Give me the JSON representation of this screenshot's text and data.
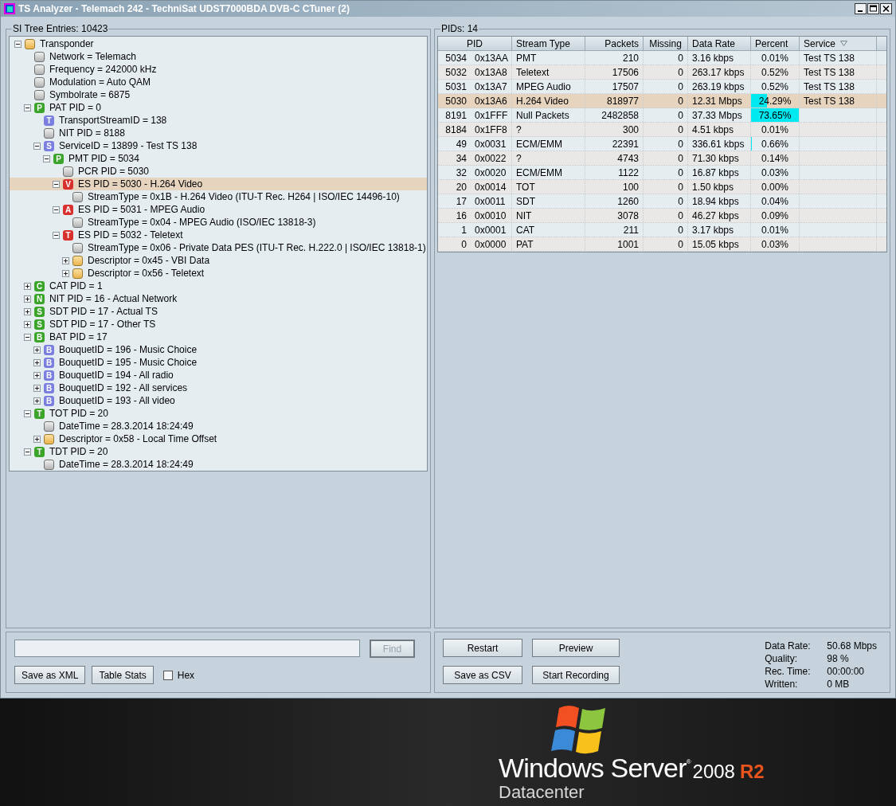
{
  "window": {
    "title": "TS Analyzer - Telemach 242 - TechniSat UDST7000BDA DVB-C CTuner (2)"
  },
  "tree_panel": {
    "legend": "SI Tree Entries: 10423",
    "nodes": [
      {
        "label": "Transponder",
        "kind": "group",
        "expanded": true,
        "selected": false,
        "children": [
          {
            "label": "Network = Telemach",
            "kind": "value",
            "selected": false
          },
          {
            "label": "Frequency = 242000 kHz",
            "kind": "value",
            "selected": false
          },
          {
            "label": "Modulation = Auto QAM",
            "kind": "value",
            "selected": false
          },
          {
            "label": "Symbolrate = 6875",
            "kind": "value",
            "selected": false
          },
          {
            "label": "PAT PID = 0",
            "kind": "table",
            "letter": "P",
            "color": "#3aa52a",
            "expanded": true,
            "selected": false,
            "children": [
              {
                "label": "TransportStreamID = 138",
                "kind": "table",
                "letter": "T",
                "color": "#7b7fe0",
                "selected": false
              },
              {
                "label": "NIT PID = 8188",
                "kind": "value",
                "selected": false
              },
              {
                "label": "ServiceID = 13899 - Test TS 138",
                "kind": "table",
                "letter": "S",
                "color": "#7b7fe0",
                "expanded": true,
                "selected": false,
                "children": [
                  {
                    "label": "PMT PID = 5034",
                    "kind": "table",
                    "letter": "P",
                    "color": "#3aa52a",
                    "expanded": true,
                    "selected": false,
                    "children": [
                      {
                        "label": "PCR PID = 5030",
                        "kind": "value",
                        "selected": false
                      },
                      {
                        "label": "ES PID = 5030 - H.264 Video",
                        "kind": "table",
                        "letter": "V",
                        "color": "#d8302c",
                        "expanded": true,
                        "selected": true,
                        "children": [
                          {
                            "label": "StreamType = 0x1B - H.264 Video (ITU-T Rec. H264 | ISO/IEC 14496-10)",
                            "kind": "value",
                            "selected": false
                          }
                        ]
                      },
                      {
                        "label": "ES PID = 5031 - MPEG Audio",
                        "kind": "table",
                        "letter": "A",
                        "color": "#d8302c",
                        "expanded": true,
                        "selected": false,
                        "children": [
                          {
                            "label": "StreamType = 0x04 - MPEG Audio (ISO/IEC 13818-3)",
                            "kind": "value",
                            "selected": false
                          }
                        ]
                      },
                      {
                        "label": "ES PID = 5032 - Teletext",
                        "kind": "table",
                        "letter": "T",
                        "color": "#d8302c",
                        "expanded": true,
                        "selected": false,
                        "children": [
                          {
                            "label": "StreamType = 0x06 - Private Data PES (ITU-T Rec. H.222.0 | ISO/IEC 13818-1)",
                            "kind": "value",
                            "selected": false
                          },
                          {
                            "label": "Descriptor = 0x45 - VBI Data",
                            "kind": "group",
                            "expanded": false,
                            "selected": false
                          },
                          {
                            "label": "Descriptor = 0x56 - Teletext",
                            "kind": "group",
                            "expanded": false,
                            "selected": false
                          }
                        ]
                      }
                    ]
                  }
                ]
              }
            ]
          },
          {
            "label": "CAT PID = 1",
            "kind": "table",
            "letter": "C",
            "color": "#3aa52a",
            "expanded": false,
            "selected": false
          },
          {
            "label": "NIT PID = 16 - Actual Network",
            "kind": "table",
            "letter": "N",
            "color": "#3aa52a",
            "expanded": false,
            "selected": false
          },
          {
            "label": "SDT PID = 17 - Actual TS",
            "kind": "table",
            "letter": "S",
            "color": "#3aa52a",
            "expanded": false,
            "selected": false
          },
          {
            "label": "SDT PID = 17 - Other TS",
            "kind": "table",
            "letter": "S",
            "color": "#3aa52a",
            "expanded": false,
            "selected": false
          },
          {
            "label": "BAT PID = 17",
            "kind": "table",
            "letter": "B",
            "color": "#3aa52a",
            "expanded": true,
            "selected": false,
            "children": [
              {
                "label": "BouquetID = 196 - Music Choice",
                "kind": "table",
                "letter": "B",
                "color": "#7b7fe0",
                "expanded": false,
                "selected": false
              },
              {
                "label": "BouquetID = 195 - Music Choice",
                "kind": "table",
                "letter": "B",
                "color": "#7b7fe0",
                "expanded": false,
                "selected": false
              },
              {
                "label": "BouquetID = 194 - All radio",
                "kind": "table",
                "letter": "B",
                "color": "#7b7fe0",
                "expanded": false,
                "selected": false
              },
              {
                "label": "BouquetID = 192 - All services",
                "kind": "table",
                "letter": "B",
                "color": "#7b7fe0",
                "expanded": false,
                "selected": false
              },
              {
                "label": "BouquetID = 193 - All video",
                "kind": "table",
                "letter": "B",
                "color": "#7b7fe0",
                "expanded": false,
                "selected": false
              }
            ]
          },
          {
            "label": "TOT PID = 20",
            "kind": "table",
            "letter": "T",
            "color": "#3aa52a",
            "expanded": true,
            "selected": false,
            "children": [
              {
                "label": "DateTime = 28.3.2014 18:24:49",
                "kind": "value",
                "selected": false
              },
              {
                "label": "Descriptor = 0x58 - Local Time Offset",
                "kind": "group",
                "expanded": false,
                "selected": false
              }
            ]
          },
          {
            "label": "TDT PID = 20",
            "kind": "table",
            "letter": "T",
            "color": "#3aa52a",
            "expanded": true,
            "selected": false,
            "children": [
              {
                "label": "DateTime = 28.3.2014 18:24:49",
                "kind": "value",
                "selected": false
              }
            ]
          }
        ]
      }
    ]
  },
  "find_button": {
    "label": "Find",
    "disabled": true
  },
  "left_buttons": [
    "Save as XML",
    "Table Stats"
  ],
  "hex_checkbox": {
    "label": "Hex",
    "checked": false
  },
  "pid_panel": {
    "legend": "PIDs: 14",
    "columns": [
      {
        "label": "PID",
        "sorted": false
      },
      {
        "label": "Stream Type",
        "sorted": false
      },
      {
        "label": "Packets",
        "sorted": false
      },
      {
        "label": "Missing",
        "sorted": false
      },
      {
        "label": "Data Rate",
        "sorted": false
      },
      {
        "label": "Percent",
        "sorted": false
      },
      {
        "label": "Service",
        "sorted": true
      }
    ],
    "rows": [
      {
        "pid": "5034",
        "hex": "0x13AA",
        "type": "PMT",
        "packets": "210",
        "missing": "0",
        "rate": "3.16 kbps",
        "percent": "0.01%",
        "service": "Test TS 138",
        "selected": false
      },
      {
        "pid": "5032",
        "hex": "0x13A8",
        "type": "Teletext",
        "packets": "17506",
        "missing": "0",
        "rate": "263.17 kbps",
        "percent": "0.52%",
        "service": "Test TS 138",
        "selected": false
      },
      {
        "pid": "5031",
        "hex": "0x13A7",
        "type": "MPEG Audio",
        "packets": "17507",
        "missing": "0",
        "rate": "263.19 kbps",
        "percent": "0.52%",
        "service": "Test TS 138",
        "selected": false
      },
      {
        "pid": "5030",
        "hex": "0x13A6",
        "type": "H.264 Video",
        "packets": "818977",
        "missing": "0",
        "rate": "12.31 Mbps",
        "percent": "24.29%",
        "level": 0.33,
        "service": "Test TS 138",
        "selected": true
      },
      {
        "pid": "8191",
        "hex": "0x1FFF",
        "type": "Null Packets",
        "packets": "2482858",
        "missing": "0",
        "rate": "37.33 Mbps",
        "percent": "73.65%",
        "level": 1,
        "selected": false
      },
      {
        "pid": "8184",
        "hex": "0x1FF8",
        "type": "?",
        "packets": "300",
        "missing": "0",
        "rate": "4.51 kbps",
        "percent": "0.01%",
        "selected": false
      },
      {
        "pid": "49",
        "hex": "0x0031",
        "type": "ECM/EMM",
        "packets": "22391",
        "missing": "0",
        "rate": "336.61 kbps",
        "percent": "0.66%",
        "level": 0.02,
        "selected": false
      },
      {
        "pid": "34",
        "hex": "0x0022",
        "type": "?",
        "packets": "4743",
        "missing": "0",
        "rate": "71.30 kbps",
        "percent": "0.14%",
        "selected": false
      },
      {
        "pid": "32",
        "hex": "0x0020",
        "type": "ECM/EMM",
        "packets": "1122",
        "missing": "0",
        "rate": "16.87 kbps",
        "percent": "0.03%",
        "selected": false
      },
      {
        "pid": "20",
        "hex": "0x0014",
        "type": "TOT",
        "packets": "100",
        "missing": "0",
        "rate": "1.50 kbps",
        "percent": "0.00%",
        "selected": false
      },
      {
        "pid": "17",
        "hex": "0x0011",
        "type": "SDT",
        "packets": "1260",
        "missing": "0",
        "rate": "18.94 kbps",
        "percent": "0.04%",
        "selected": false
      },
      {
        "pid": "16",
        "hex": "0x0010",
        "type": "NIT",
        "packets": "3078",
        "missing": "0",
        "rate": "46.27 kbps",
        "percent": "0.09%",
        "selected": false
      },
      {
        "pid": "1",
        "hex": "0x0001",
        "type": "CAT",
        "packets": "211",
        "missing": "0",
        "rate": "3.17 kbps",
        "percent": "0.01%",
        "selected": false
      },
      {
        "pid": "0",
        "hex": "0x0000",
        "type": "PAT",
        "packets": "1001",
        "missing": "0",
        "rate": "15.05 kbps",
        "percent": "0.03%",
        "selected": false
      }
    ]
  },
  "right_buttons": [
    "Restart",
    "Preview",
    "Save as CSV",
    "Start Recording"
  ],
  "stats": [
    {
      "label": "Data Rate:",
      "value": "50.68 Mbps"
    },
    {
      "label": "Quality:",
      "value": "98 %"
    },
    {
      "label": "Rec. Time:",
      "value": "00:00:00"
    },
    {
      "label": "Written:",
      "value": "0 MB"
    }
  ],
  "wallpaper": {
    "brand": "Windows Server",
    "mark": "®",
    "version": "2008",
    "tag": "R2",
    "edition": "Datacenter"
  }
}
